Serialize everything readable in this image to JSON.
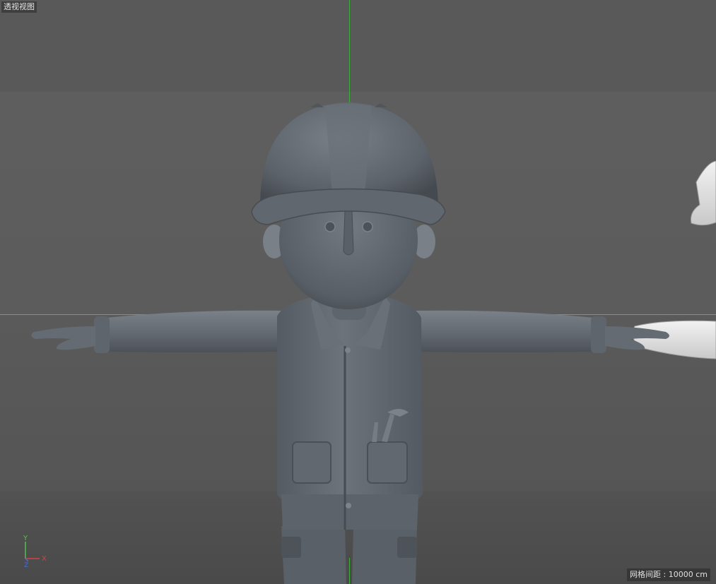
{
  "viewport": {
    "view_name": "透视视图",
    "grid_spacing": "网格间距 : 10000 cm"
  },
  "axis_gizmo": {
    "y_label": "Y",
    "x_label": "X",
    "z_label": "Z",
    "y_color": "#4fc24f",
    "x_color": "#d64040",
    "z_color": "#4a6ad6"
  },
  "scene": {
    "model_color": "#6a7077",
    "second_model_color": "#d8d8d8",
    "y_axis_color": "#3fae3f"
  }
}
